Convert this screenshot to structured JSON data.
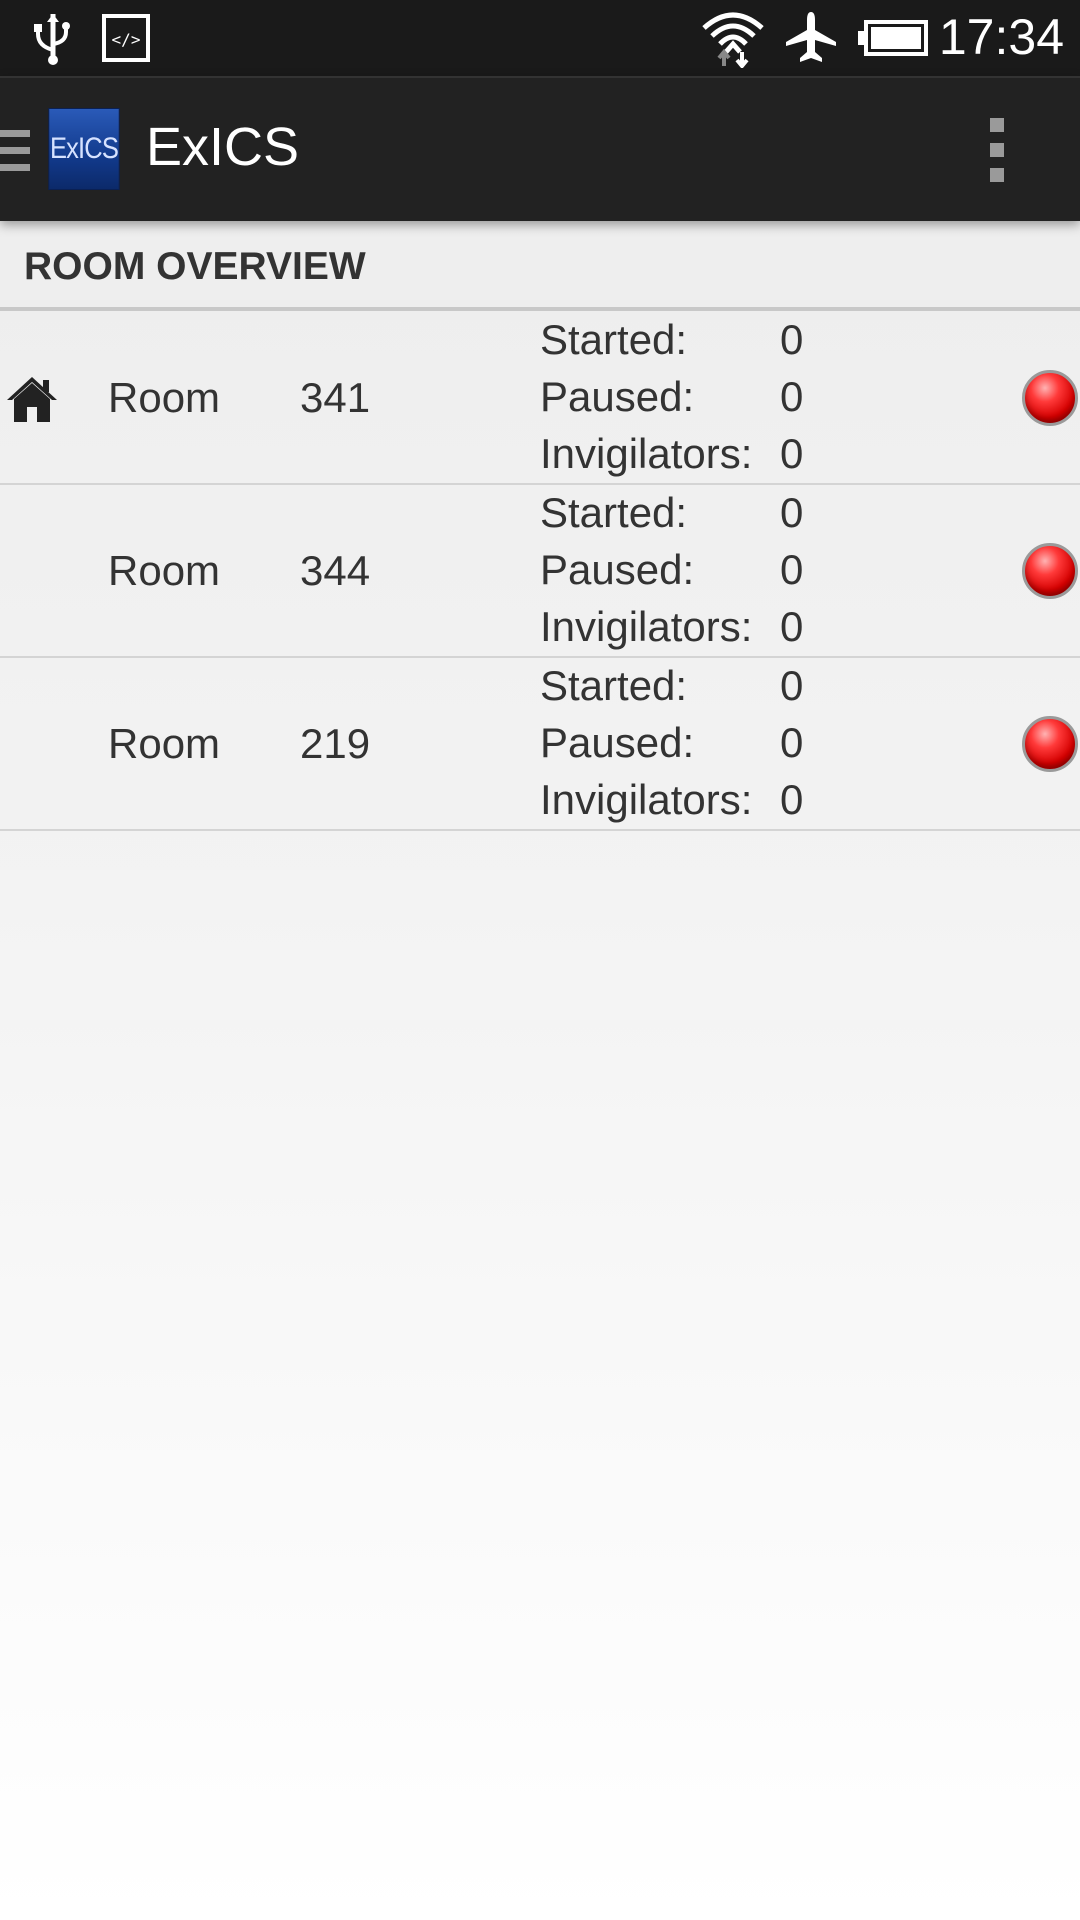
{
  "status_bar": {
    "time": "17:34"
  },
  "action_bar": {
    "logo_text": "ExICS",
    "title": "ExICS"
  },
  "section": {
    "title": "ROOM OVERVIEW"
  },
  "rooms": [
    {
      "label": "Room",
      "number": "341",
      "is_home": true,
      "started_label": "Started:",
      "started": "0",
      "paused_label": "Paused:",
      "paused": "0",
      "invigilators_label": "Invigilators:",
      "invigilators": "0",
      "status_color": "#e00000"
    },
    {
      "label": "Room",
      "number": "344",
      "is_home": false,
      "started_label": "Started:",
      "started": "0",
      "paused_label": "Paused:",
      "paused": "0",
      "invigilators_label": "Invigilators:",
      "invigilators": "0",
      "status_color": "#e00000"
    },
    {
      "label": "Room",
      "number": "219",
      "is_home": false,
      "started_label": "Started:",
      "started": "0",
      "paused_label": "Paused:",
      "paused": "0",
      "invigilators_label": "Invigilators:",
      "invigilators": "0",
      "status_color": "#e00000"
    }
  ],
  "icons": {
    "status_left": [
      "usb-icon",
      "developer-mode-icon"
    ],
    "status_right": [
      "wifi-icon",
      "airplane-mode-icon",
      "battery-icon"
    ],
    "row_home": "home-icon",
    "row_status": "status-light-icon"
  }
}
